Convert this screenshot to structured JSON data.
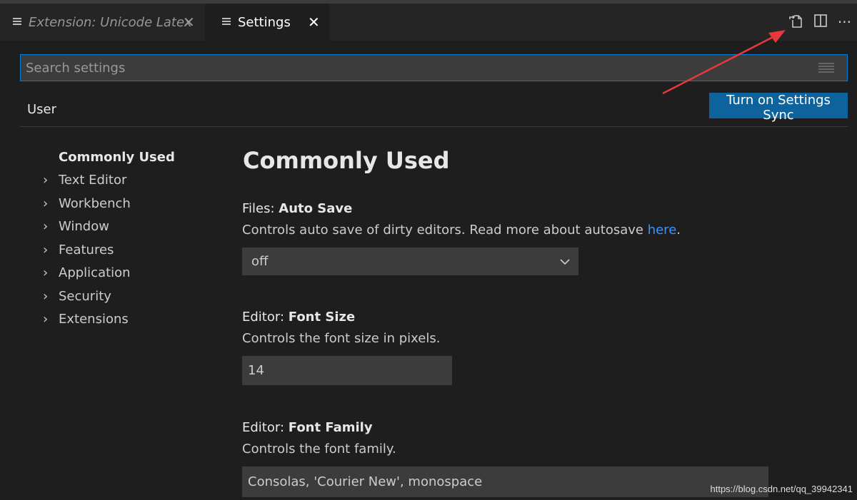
{
  "tabs": [
    {
      "label": "Extension: Unicode Latex",
      "active": false
    },
    {
      "label": "Settings",
      "active": true
    }
  ],
  "tab_close": "✕",
  "actions": {
    "more": "···"
  },
  "search": {
    "placeholder": "Search settings"
  },
  "scope_tabs": [
    "User"
  ],
  "sync_button": "Turn on Settings Sync",
  "toc": {
    "selected": "Commonly Used",
    "items": [
      "Text Editor",
      "Workbench",
      "Window",
      "Features",
      "Application",
      "Security",
      "Extensions"
    ]
  },
  "section_title": "Commonly Used",
  "settings": [
    {
      "category": "Files: ",
      "name": "Auto Save",
      "description": "Controls auto save of dirty editors. Read more about autosave ",
      "link": "here",
      "suffix": ".",
      "value": "off"
    },
    {
      "category": "Editor: ",
      "name": "Font Size",
      "description": "Controls the font size in pixels.",
      "value": "14"
    },
    {
      "category": "Editor: ",
      "name": "Font Family",
      "description": "Controls the font family.",
      "value": "Consolas, 'Courier New', monospace"
    }
  ],
  "watermark": "https://blog.csdn.net/qq_39942341",
  "colors": {
    "accent": "#0e639c",
    "focus": "#007fd4",
    "arrow": "#e8383d"
  }
}
